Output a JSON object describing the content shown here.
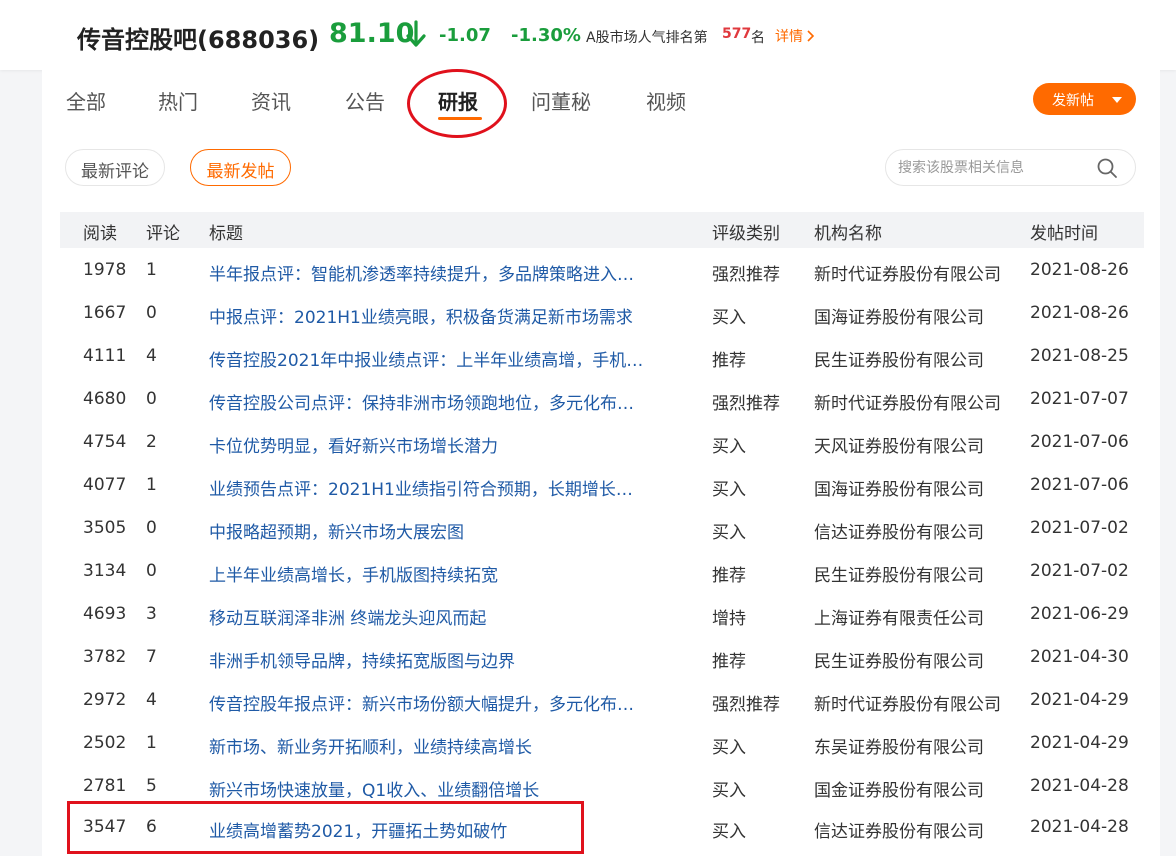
{
  "header": {
    "stock_name": "传音控股吧(688036)",
    "price": "81.10",
    "change": "-1.07",
    "change_pct": "-1.30%",
    "rank_label": "A股市场人气排名第",
    "rank_value": "577",
    "rank_unit": "名",
    "detail_link": "详情",
    "down_color": "#1a9d3c",
    "accent_color": "#ff6a00"
  },
  "tabs": [
    {
      "label": "全部"
    },
    {
      "label": "热门"
    },
    {
      "label": "资讯"
    },
    {
      "label": "公告"
    },
    {
      "label": "研报",
      "active": true
    },
    {
      "label": "问董秘"
    },
    {
      "label": "视频"
    }
  ],
  "post_button": {
    "label": "发新帖"
  },
  "filters": [
    {
      "label": "最新评论"
    },
    {
      "label": "最新发帖",
      "active": true
    }
  ],
  "search": {
    "placeholder": "搜索该股票相关信息"
  },
  "table": {
    "headers": {
      "read": "阅读",
      "comment": "评论",
      "title": "标题",
      "rating": "评级类别",
      "org": "机构名称",
      "date": "发帖时间"
    },
    "rows": [
      {
        "read": "1978",
        "comment": "1",
        "title": "半年报点评：智能机渗透率持续提升，多品牌策略进入…",
        "rating": "强烈推荐",
        "org": "新时代证券股份有限公司",
        "date": "2021-08-26"
      },
      {
        "read": "1667",
        "comment": "0",
        "title": "中报点评：2021H1业绩亮眼，积极备货满足新市场需求",
        "rating": "买入",
        "org": "国海证券股份有限公司",
        "date": "2021-08-26"
      },
      {
        "read": "4111",
        "comment": "4",
        "title": "传音控股2021年中报业绩点评：上半年业绩高增，手机…",
        "rating": "推荐",
        "org": "民生证券股份有限公司",
        "date": "2021-08-25"
      },
      {
        "read": "4680",
        "comment": "0",
        "title": "传音控股公司点评：保持非洲市场领跑地位，多元化布…",
        "rating": "强烈推荐",
        "org": "新时代证券股份有限公司",
        "date": "2021-07-07"
      },
      {
        "read": "4754",
        "comment": "2",
        "title": "卡位优势明显，看好新兴市场增长潜力",
        "rating": "买入",
        "org": "天风证券股份有限公司",
        "date": "2021-07-06"
      },
      {
        "read": "4077",
        "comment": "1",
        "title": "业绩预告点评：2021H1业绩指引符合预期，长期增长…",
        "rating": "买入",
        "org": "国海证券股份有限公司",
        "date": "2021-07-06"
      },
      {
        "read": "3505",
        "comment": "0",
        "title": "中报略超预期，新兴市场大展宏图",
        "rating": "买入",
        "org": "信达证券股份有限公司",
        "date": "2021-07-02"
      },
      {
        "read": "3134",
        "comment": "0",
        "title": "上半年业绩高增长，手机版图持续拓宽",
        "rating": "推荐",
        "org": "民生证券股份有限公司",
        "date": "2021-07-02"
      },
      {
        "read": "4693",
        "comment": "3",
        "title": "移动互联润泽非洲 终端龙头迎风而起",
        "rating": "增持",
        "org": "上海证券有限责任公司",
        "date": "2021-06-29"
      },
      {
        "read": "3782",
        "comment": "7",
        "title": "非洲手机领导品牌，持续拓宽版图与边界",
        "rating": "推荐",
        "org": "民生证券股份有限公司",
        "date": "2021-04-30"
      },
      {
        "read": "2972",
        "comment": "4",
        "title": "传音控股年报点评：新兴市场份额大幅提升，多元化布…",
        "rating": "强烈推荐",
        "org": "新时代证券股份有限公司",
        "date": "2021-04-29"
      },
      {
        "read": "2502",
        "comment": "1",
        "title": "新市场、新业务开拓顺利，业绩持续高增长",
        "rating": "买入",
        "org": "东吴证券股份有限公司",
        "date": "2021-04-29"
      },
      {
        "read": "2781",
        "comment": "5",
        "title": "新兴市场快速放量，Q1收入、业绩翻倍增长",
        "rating": "买入",
        "org": "国金证券股份有限公司",
        "date": "2021-04-28"
      },
      {
        "read": "3547",
        "comment": "6",
        "title": "业绩高增蓄势2021，开疆拓土势如破竹",
        "rating": "买入",
        "org": "信达证券股份有限公司",
        "date": "2021-04-28"
      }
    ]
  }
}
